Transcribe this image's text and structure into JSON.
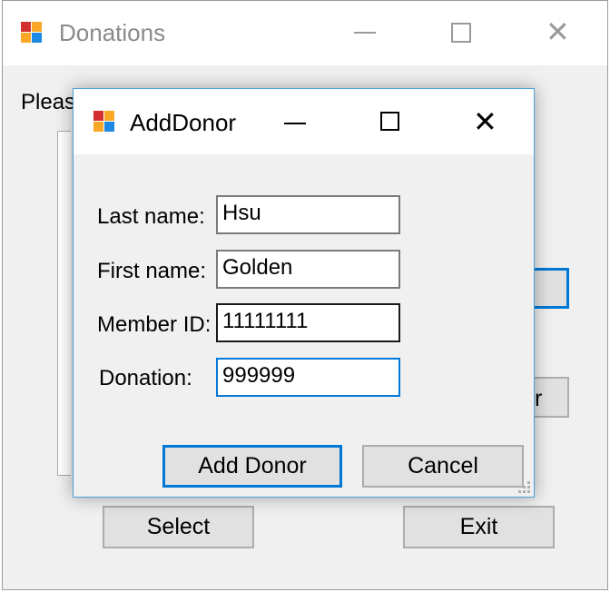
{
  "main_window": {
    "title": "Donations",
    "prompt_text": "Pleas",
    "buttons": {
      "select": "Select",
      "exit": "Exit",
      "partial_r": "r"
    }
  },
  "dialog": {
    "title": "AddDonor",
    "labels": {
      "last_name": "Last name:",
      "first_name": "First name:",
      "member_id": "Member ID:",
      "donation": "Donation:"
    },
    "values": {
      "last_name": "Hsu",
      "first_name": "Golden",
      "member_id": "11111111",
      "donation": "999999"
    },
    "buttons": {
      "add_donor": "Add Donor",
      "cancel": "Cancel"
    }
  },
  "colors": {
    "accent": "#0078d7",
    "window_bg": "#f0f0f0",
    "titlebar_bg": "#ffffff",
    "button_bg": "#e1e1e1"
  },
  "icons": [
    "app-icon",
    "minimize-icon",
    "maximize-icon",
    "close-icon",
    "resize-grip-icon"
  ]
}
